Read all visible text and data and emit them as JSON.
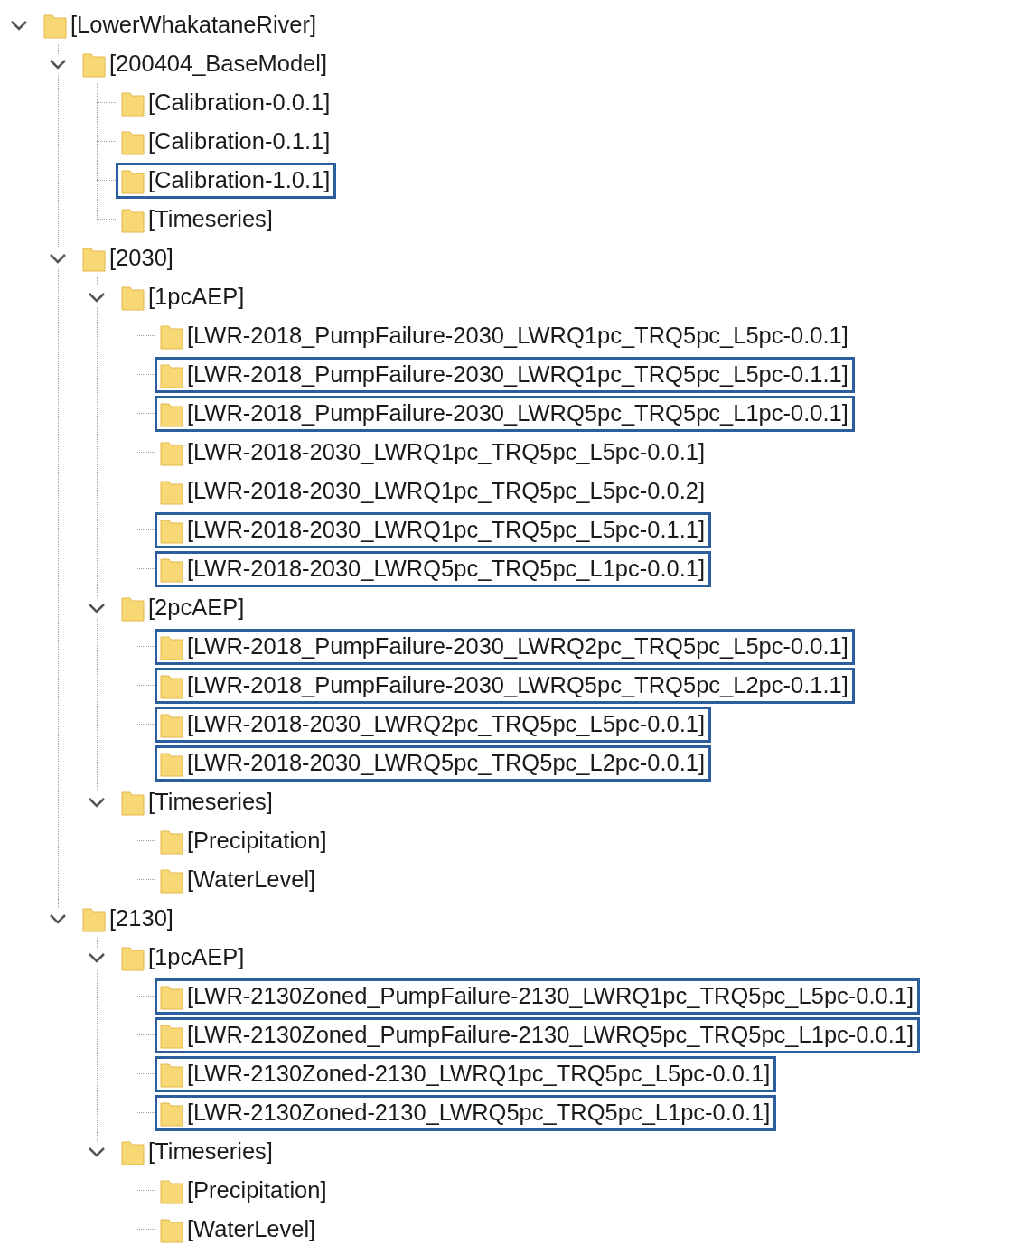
{
  "tree": [
    {
      "label": "[LowerWhakataneRiver]",
      "expanded": true,
      "highlighted": false,
      "children": [
        {
          "label": "[200404_BaseModel]",
          "expanded": true,
          "highlighted": false,
          "children": [
            {
              "label": "[Calibration-0.0.1]",
              "highlighted": false
            },
            {
              "label": "[Calibration-0.1.1]",
              "highlighted": false
            },
            {
              "label": "[Calibration-1.0.1]",
              "highlighted": true
            },
            {
              "label": "[Timeseries]",
              "highlighted": false
            }
          ]
        },
        {
          "label": "[2030]",
          "expanded": true,
          "highlighted": false,
          "children": [
            {
              "label": "[1pcAEP]",
              "expanded": true,
              "highlighted": false,
              "children": [
                {
                  "label": "[LWR-2018_PumpFailure-2030_LWRQ1pc_TRQ5pc_L5pc-0.0.1]",
                  "highlighted": false
                },
                {
                  "label": "[LWR-2018_PumpFailure-2030_LWRQ1pc_TRQ5pc_L5pc-0.1.1]",
                  "highlighted": true
                },
                {
                  "label": "[LWR-2018_PumpFailure-2030_LWRQ5pc_TRQ5pc_L1pc-0.0.1]",
                  "highlighted": true
                },
                {
                  "label": "[LWR-2018-2030_LWRQ1pc_TRQ5pc_L5pc-0.0.1]",
                  "highlighted": false
                },
                {
                  "label": "[LWR-2018-2030_LWRQ1pc_TRQ5pc_L5pc-0.0.2]",
                  "highlighted": false
                },
                {
                  "label": "[LWR-2018-2030_LWRQ1pc_TRQ5pc_L5pc-0.1.1]",
                  "highlighted": true
                },
                {
                  "label": "[LWR-2018-2030_LWRQ5pc_TRQ5pc_L1pc-0.0.1]",
                  "highlighted": true
                }
              ]
            },
            {
              "label": "[2pcAEP]",
              "expanded": true,
              "highlighted": false,
              "children": [
                {
                  "label": "[LWR-2018_PumpFailure-2030_LWRQ2pc_TRQ5pc_L5pc-0.0.1]",
                  "highlighted": true
                },
                {
                  "label": "[LWR-2018_PumpFailure-2030_LWRQ5pc_TRQ5pc_L2pc-0.1.1]",
                  "highlighted": true
                },
                {
                  "label": "[LWR-2018-2030_LWRQ2pc_TRQ5pc_L5pc-0.0.1]",
                  "highlighted": true
                },
                {
                  "label": "[LWR-2018-2030_LWRQ5pc_TRQ5pc_L2pc-0.0.1]",
                  "highlighted": true
                }
              ]
            },
            {
              "label": "[Timeseries]",
              "expanded": true,
              "highlighted": false,
              "children": [
                {
                  "label": "[Precipitation]",
                  "highlighted": false
                },
                {
                  "label": "[WaterLevel]",
                  "highlighted": false
                }
              ]
            }
          ]
        },
        {
          "label": "[2130]",
          "expanded": true,
          "highlighted": false,
          "children": [
            {
              "label": "[1pcAEP]",
              "expanded": true,
              "highlighted": false,
              "children": [
                {
                  "label": "[LWR-2130Zoned_PumpFailure-2130_LWRQ1pc_TRQ5pc_L5pc-0.0.1]",
                  "highlighted": true
                },
                {
                  "label": "[LWR-2130Zoned_PumpFailure-2130_LWRQ5pc_TRQ5pc_L1pc-0.0.1]",
                  "highlighted": true
                },
                {
                  "label": "[LWR-2130Zoned-2130_LWRQ1pc_TRQ5pc_L5pc-0.0.1]",
                  "highlighted": true
                },
                {
                  "label": "[LWR-2130Zoned-2130_LWRQ5pc_TRQ5pc_L1pc-0.0.1]",
                  "highlighted": true
                }
              ]
            },
            {
              "label": "[Timeseries]",
              "expanded": true,
              "highlighted": false,
              "children": [
                {
                  "label": "[Precipitation]",
                  "highlighted": false
                },
                {
                  "label": "[WaterLevel]",
                  "highlighted": false
                }
              ]
            }
          ]
        }
      ]
    }
  ]
}
